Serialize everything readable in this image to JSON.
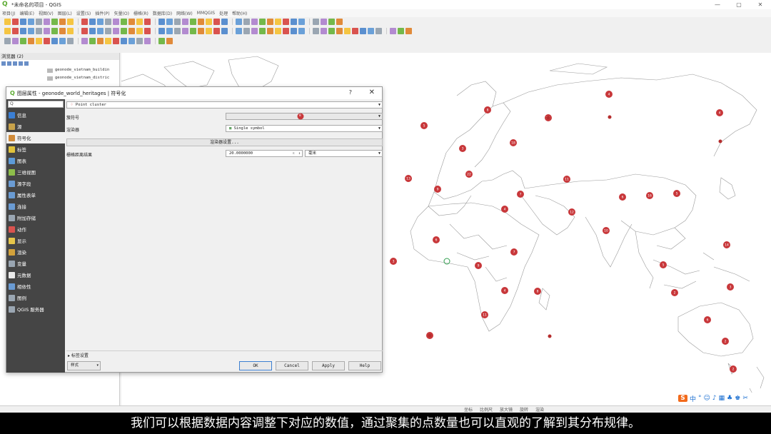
{
  "window": {
    "title": "*未命名的项目 - QGIS",
    "controls": [
      "—",
      "▢",
      "✕"
    ]
  },
  "menubar": [
    "项目(J)",
    "编辑(E)",
    "视图(V)",
    "图层(L)",
    "设置(S)",
    "插件(P)",
    "矢量(O)",
    "栅格(R)",
    "数据库(D)",
    "网络(W)",
    "MMQGIS",
    "处理",
    "帮助(H)"
  ],
  "browser": {
    "title": "浏览器 (2)",
    "items": [
      "geonode_vietnam_buildin",
      "geonode_vietnam_distric"
    ]
  },
  "dialog": {
    "title": "图层属性 - geonode_world_heritages | 符号化",
    "help": "?",
    "close": "✕",
    "search_placeholder": "Q",
    "sidebar": [
      {
        "label": "信息",
        "icon": "info-icon",
        "color": "#3b7fd4"
      },
      {
        "label": "源",
        "icon": "source-icon",
        "color": "#c8a24a"
      },
      {
        "label": "符号化",
        "icon": "symbology-icon",
        "color": "#d08b3a",
        "active": true
      },
      {
        "label": "标签",
        "icon": "labels-icon",
        "color": "#e0c23b"
      },
      {
        "label": "图表",
        "icon": "diagrams-icon",
        "color": "#5c9ad8"
      },
      {
        "label": "三维视图",
        "icon": "3d-view-icon",
        "color": "#8dbd4a"
      },
      {
        "label": "源字段",
        "icon": "fields-icon",
        "color": "#6a9bd3"
      },
      {
        "label": "属性表单",
        "icon": "attributes-form-icon",
        "color": "#6a9bd3"
      },
      {
        "label": "连接",
        "icon": "joins-icon",
        "color": "#6a9bd3"
      },
      {
        "label": "附加存储",
        "icon": "aux-storage-icon",
        "color": "#9aa6b2"
      },
      {
        "label": "动作",
        "icon": "actions-icon",
        "color": "#d9534f"
      },
      {
        "label": "显示",
        "icon": "display-icon",
        "color": "#e5c54a"
      },
      {
        "label": "渲染",
        "icon": "rendering-icon",
        "color": "#d2a13b"
      },
      {
        "label": "变量",
        "icon": "variables-icon",
        "color": "#9aa6b2"
      },
      {
        "label": "元数据",
        "icon": "metadata-icon",
        "color": "#e9e9e9"
      },
      {
        "label": "相依性",
        "icon": "dependencies-icon",
        "color": "#6a9bd3"
      },
      {
        "label": "图例",
        "icon": "legend-icon",
        "color": "#9aa6b2"
      },
      {
        "label": "QGIS 服务器",
        "icon": "qgis-server-icon",
        "color": "#9aa6b2"
      }
    ],
    "renderer_type": "Point cluster",
    "cluster_symbol_label": "簇符号",
    "cluster_symbol_value": "8",
    "renderer_label": "渲染器",
    "renderer_value": "Single symbol",
    "renderer_settings_button": "渲染器设置...",
    "distance_label": "栅格距离结果",
    "distance_value": "20.0000000",
    "distance_unit": "毫米",
    "label_section": "标签设置",
    "style_button": "样式",
    "buttons": {
      "ok": "OK",
      "cancel": "Cancel",
      "apply": "Apply",
      "help": "Help"
    }
  },
  "status": [
    "坐标",
    "比例尺",
    "放大镜",
    "旋转",
    "渲染"
  ],
  "map": {
    "clusters": [
      {
        "label": "5"
      },
      {
        "label": "8"
      },
      {
        "label": "4"
      },
      {
        "label": "15"
      },
      {
        "label": "3"
      },
      {
        "label": "18"
      },
      {
        "label": "22"
      },
      {
        "label": "13"
      },
      {
        "label": "9"
      },
      {
        "label": "7"
      },
      {
        "label": "11"
      },
      {
        "label": "6"
      },
      {
        "label": "16"
      },
      {
        "label": "5"
      },
      {
        "label": "4"
      },
      {
        "label": "12"
      },
      {
        "label": "10"
      },
      {
        "label": "6"
      },
      {
        "label": "7"
      },
      {
        "label": "3"
      },
      {
        "label": "9"
      },
      {
        "label": "5"
      },
      {
        "label": "14"
      },
      {
        "label": "8"
      },
      {
        "label": "4"
      },
      {
        "label": "2"
      },
      {
        "label": "11"
      },
      {
        "label": "6"
      },
      {
        "label": "3"
      },
      {
        "label": "2"
      },
      {
        "label": "2"
      },
      {
        "label": "4"
      },
      {
        "label": "3"
      }
    ],
    "cluster_color": "#c8373a",
    "singleton_color": "#b52d2d"
  },
  "ime": [
    "S",
    "中",
    "°",
    "☺",
    "♪",
    "▦",
    "♣",
    "♚",
    "✂"
  ],
  "subtitle": "我们可以根据数据内容调整下对应的数值，通过聚集的点数量也可以直观的了解到其分布规律。"
}
